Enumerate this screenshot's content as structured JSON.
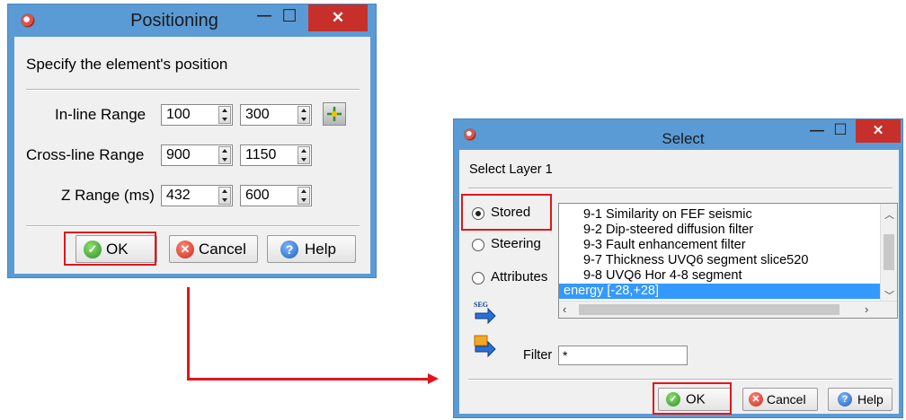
{
  "positioning": {
    "title": "Positioning",
    "minimize_glyph": "—",
    "maximize_glyph": "☐",
    "close_glyph": "✕",
    "description": "Specify the element's position",
    "ranges": [
      {
        "label": "In-line Range",
        "from": "100",
        "to": "300"
      },
      {
        "label": "Cross-line Range",
        "from": "900",
        "to": "1150"
      },
      {
        "label": "Z Range (ms)",
        "from": "432",
        "to": "600"
      }
    ],
    "ok_label": "OK",
    "cancel_label": "Cancel",
    "help_label": "Help",
    "icon_names": [
      "app-icon",
      "locate-icon",
      "check-icon",
      "cancel-x-icon",
      "help-question-icon"
    ]
  },
  "select": {
    "title": "Select",
    "minimize_glyph": "—",
    "maximize_glyph": "☐",
    "close_glyph": "✕",
    "layer_label": "Select Layer 1",
    "radios": [
      {
        "label": "Stored",
        "checked": true
      },
      {
        "label": "Steering",
        "checked": false
      },
      {
        "label": "Attributes",
        "checked": false
      }
    ],
    "list_items": [
      "9-1 Similarity on FEF seismic",
      "9-2 Dip-steered diffusion filter",
      "9-3 Fault enhancement filter",
      "9-7 Thickness UVQ6 segment slice520",
      "9-8 UVQ6 Hor 4-8 segment",
      "energy [-28,+28]"
    ],
    "selected_item": "energy [-28,+28]",
    "filter_label": "Filter",
    "filter_value": "*",
    "seg_icon_text": "SEG",
    "ok_label": "OK",
    "cancel_label": "Cancel",
    "help_label": "Help"
  },
  "colors": {
    "title_bar": "#5b9bd5",
    "close_button": "#c7302a",
    "highlight_box": "#e0161c",
    "selection": "#3399ff"
  }
}
